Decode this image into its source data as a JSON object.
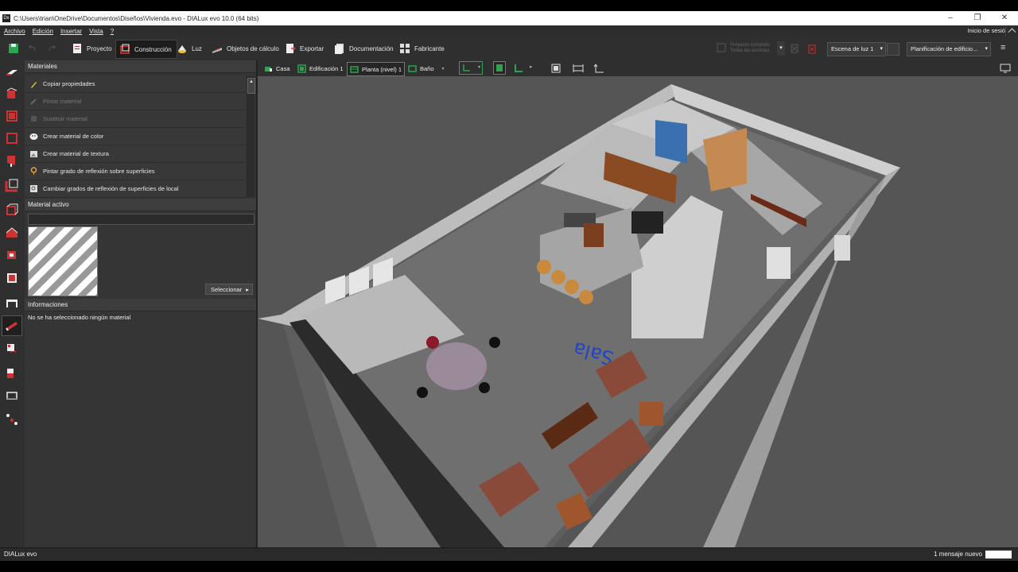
{
  "window": {
    "title": "C:\\Users\\trian\\OneDrive\\Documentos\\Diseños\\Vivienda.evo - DIALux evo 10.0  (64 bits)",
    "app_icon": "Dx"
  },
  "menu": {
    "items": [
      "Archivo",
      "Edición",
      "Insertar",
      "Vista",
      "?"
    ],
    "session": "Inicio de sesión"
  },
  "toolbar": {
    "tabs": [
      {
        "label": "Proyecto",
        "icon": "project-icon"
      },
      {
        "label": "Construcción",
        "icon": "construction-icon"
      },
      {
        "label": "Luz",
        "icon": "light-icon"
      },
      {
        "label": "Objetos de cálculo",
        "icon": "calc-objects-icon"
      },
      {
        "label": "Exportar",
        "icon": "export-icon"
      },
      {
        "label": "Documentación",
        "icon": "documentation-icon"
      },
      {
        "label": "Fabricante",
        "icon": "manufacturer-icon"
      }
    ],
    "active_tab": "Construcción",
    "project_status": {
      "line1": "Proyecto completo",
      "line2": "Todas las escenas"
    },
    "light_scene": "Escena de luz 1",
    "planning": "Planificación de edificio..."
  },
  "panel": {
    "materials_header": "Materiales",
    "material_actions": [
      {
        "label": "Copiar propiedades",
        "enabled": true,
        "icon": "pipette-icon"
      },
      {
        "label": "Pintar material",
        "enabled": false,
        "icon": "paint-icon"
      },
      {
        "label": "Sustituir material",
        "enabled": false,
        "icon": "replace-icon"
      },
      {
        "label": "Crear material de color",
        "enabled": true,
        "icon": "color-palette-icon"
      },
      {
        "label": "Crear material de textura",
        "enabled": true,
        "icon": "texture-icon"
      },
      {
        "label": "Pintar grado de reflexión sobre superficies",
        "enabled": true,
        "icon": "reflection-paint-icon"
      },
      {
        "label": "Cambiar grados de reflexión de superficies de local",
        "enabled": true,
        "icon": "reflection-change-icon"
      }
    ],
    "active_material_header": "Material activo",
    "select_button": "Seleccionar",
    "info_header": "Informaciones",
    "info_text": "No se ha seleccionado ningún material"
  },
  "view_toolbar": {
    "breadcrumb": [
      {
        "label": "Casa",
        "icon": "house-icon"
      },
      {
        "label": "Edificación 1",
        "icon": "building-icon"
      },
      {
        "label": "Planta (nivel) 1",
        "icon": "floor-icon"
      },
      {
        "label": "Baño",
        "icon": "room-icon"
      }
    ]
  },
  "scene_labels": {
    "room_name": "Sala"
  },
  "status": {
    "logo": "DIALux evo",
    "message": "1 mensaje nuevo"
  },
  "colors": {
    "accent_green": "#2ea44f",
    "active_red": "#cc2a2a",
    "floor": "#6f6f6f",
    "wall": "#c9c9c9",
    "furniture": "#8a4a3a"
  }
}
